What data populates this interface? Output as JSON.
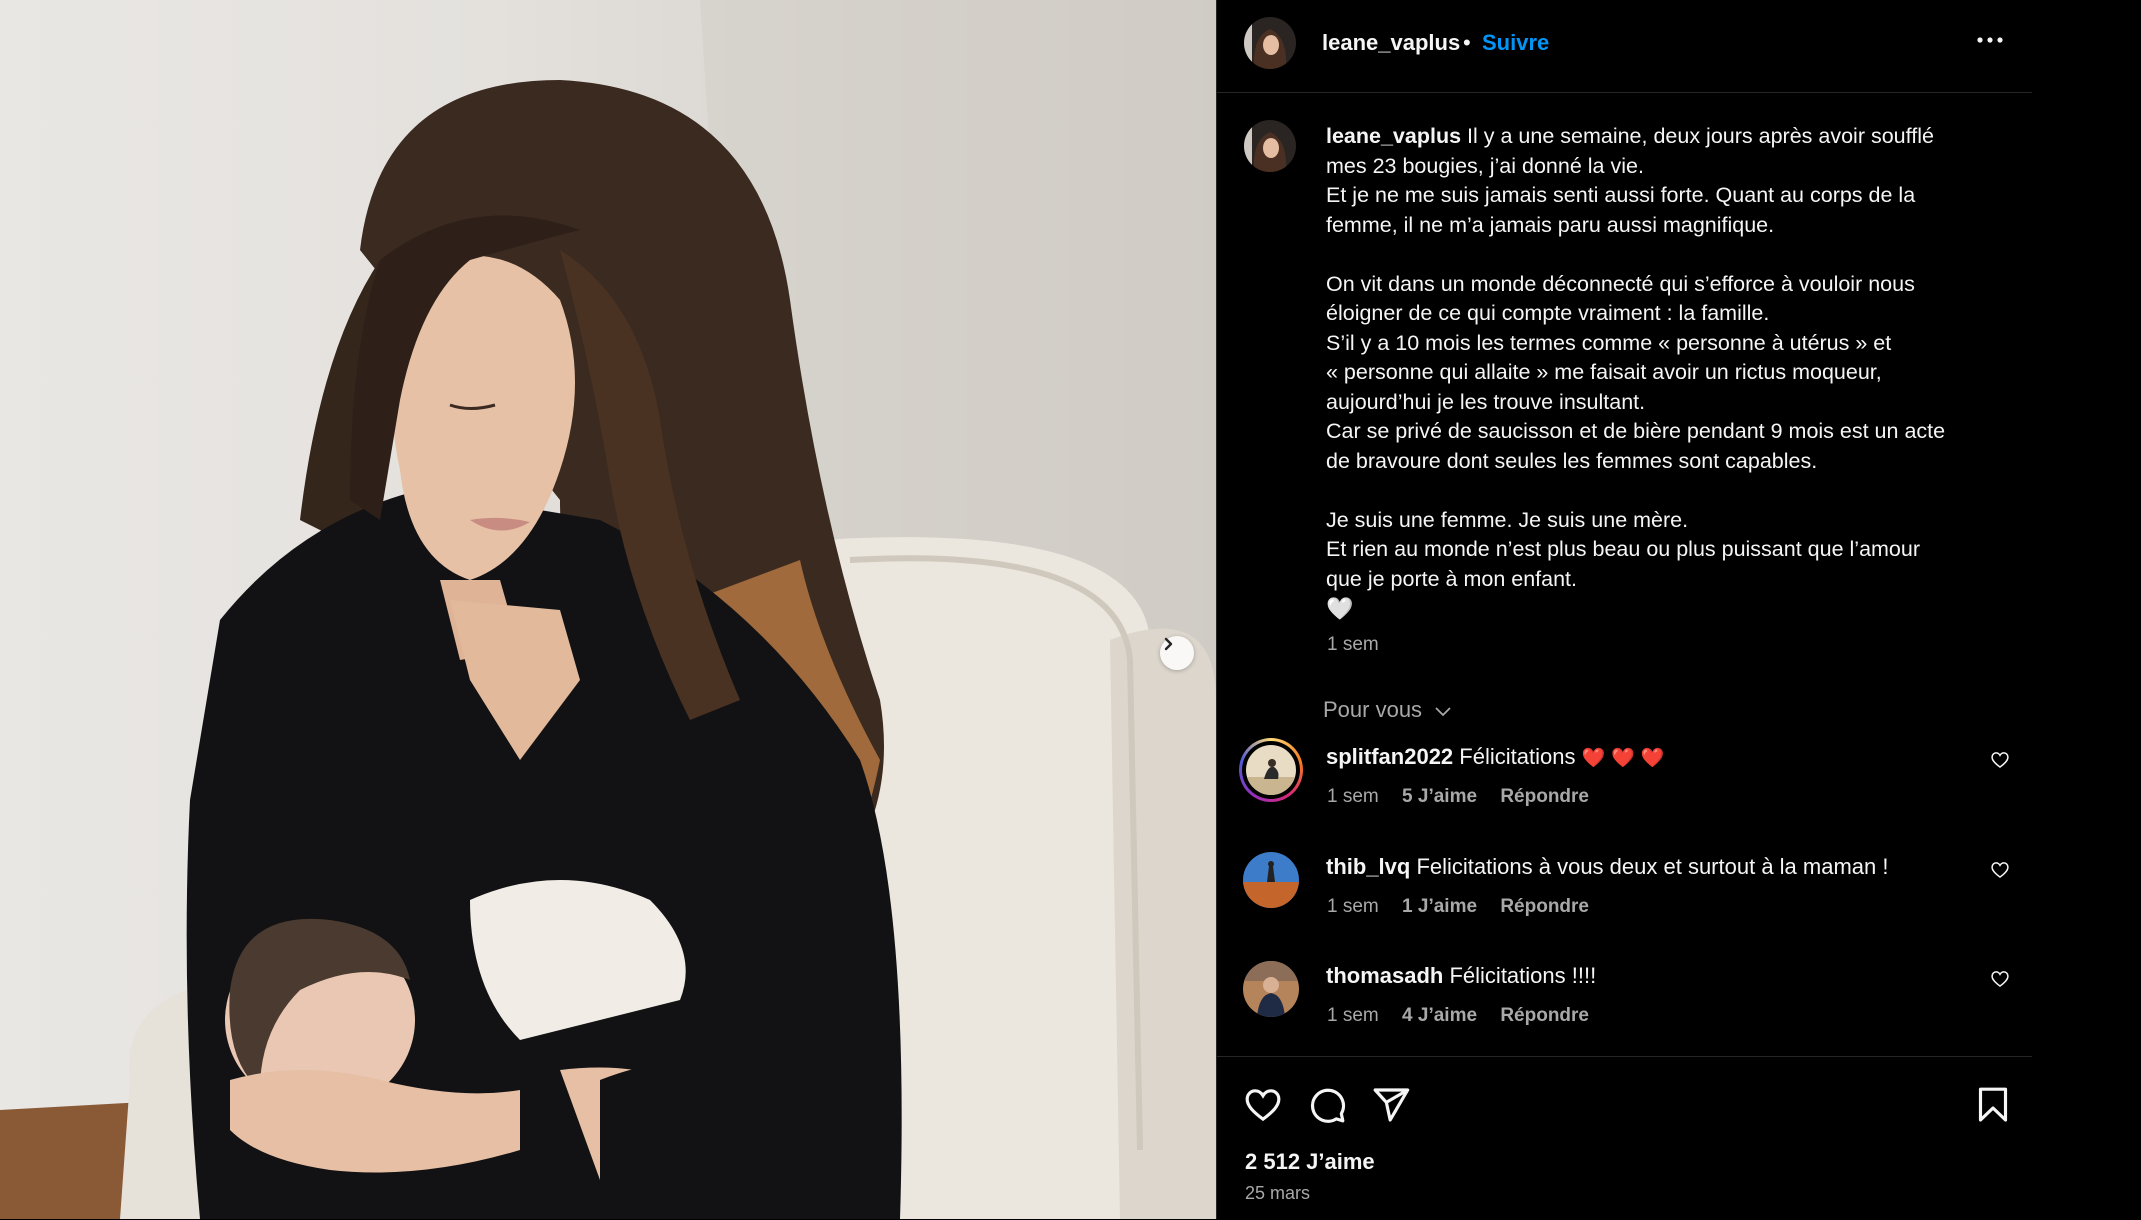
{
  "post": {
    "username": "leane_vaplus",
    "separator": "•",
    "follow_label": "Suivre",
    "caption_lines": [
      "Il y a une semaine, deux jours après avoir soufflé",
      "mes 23 bougies, j’ai donné la vie.",
      "Et je ne me suis jamais senti aussi forte. Quant au corps de la",
      "femme, il ne m’a jamais paru aussi magnifique.",
      "",
      "On vit dans un monde déconnecté qui s’efforce à vouloir nous",
      "éloigner de ce qui compte vraiment : la famille.",
      "S’il y a 10 mois les termes comme « personne à utérus » et",
      "« personne qui allaite » me faisait avoir un rictus moqueur,",
      "aujourd’hui je les trouve insultant.",
      "Car se privé de saucisson et de bière pendant 9 mois est un acte",
      "de bravoure dont seules les femmes sont capables.",
      "",
      "Je suis une femme. Je suis une mère.",
      "Et rien au monde n’est plus beau ou plus puissant que l’amour",
      "que je porte à mon enfant."
    ],
    "caption_emoji": "🤍",
    "caption_time": "1 sem",
    "likes": "2 512 J’aime",
    "date": "25 mars"
  },
  "comments_filter": "Pour vous",
  "comments": [
    {
      "username": "splitfan2022",
      "text": "Félicitations",
      "emoji": "❤️❤️❤️",
      "time": "1 sem",
      "likes": "5 J’aime",
      "reply": "Répondre"
    },
    {
      "username": "thib_lvq",
      "text": "Felicitations à vous deux et surtout à la maman !",
      "emoji": "",
      "time": "1 sem",
      "likes": "1 J’aime",
      "reply": "Répondre"
    },
    {
      "username": "thomasadh",
      "text": "Félicitations !!!!",
      "emoji": "",
      "time": "1 sem",
      "likes": "4 J’aime",
      "reply": "Répondre"
    }
  ],
  "icons": {
    "more": "more-horizontal-icon",
    "next": "chevron-right-icon",
    "like": "heart-icon",
    "comment": "comment-icon",
    "share": "paper-plane-icon",
    "save": "bookmark-icon"
  },
  "colors": {
    "background": "#000000",
    "text": "#f5f5f5",
    "secondary_text": "#a8a8a8",
    "follow_blue": "#0095f6",
    "divider": "#262626",
    "heart_red": "#ff3040"
  }
}
